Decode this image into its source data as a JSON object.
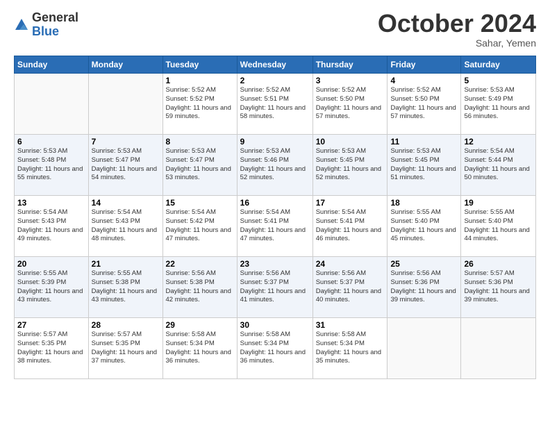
{
  "logo": {
    "general": "General",
    "blue": "Blue"
  },
  "header": {
    "month": "October 2024",
    "location": "Sahar, Yemen"
  },
  "weekdays": [
    "Sunday",
    "Monday",
    "Tuesday",
    "Wednesday",
    "Thursday",
    "Friday",
    "Saturday"
  ],
  "weeks": [
    [
      {
        "day": "",
        "sunrise": "",
        "sunset": "",
        "daylight": ""
      },
      {
        "day": "",
        "sunrise": "",
        "sunset": "",
        "daylight": ""
      },
      {
        "day": "1",
        "sunrise": "Sunrise: 5:52 AM",
        "sunset": "Sunset: 5:52 PM",
        "daylight": "Daylight: 11 hours and 59 minutes."
      },
      {
        "day": "2",
        "sunrise": "Sunrise: 5:52 AM",
        "sunset": "Sunset: 5:51 PM",
        "daylight": "Daylight: 11 hours and 58 minutes."
      },
      {
        "day": "3",
        "sunrise": "Sunrise: 5:52 AM",
        "sunset": "Sunset: 5:50 PM",
        "daylight": "Daylight: 11 hours and 57 minutes."
      },
      {
        "day": "4",
        "sunrise": "Sunrise: 5:52 AM",
        "sunset": "Sunset: 5:50 PM",
        "daylight": "Daylight: 11 hours and 57 minutes."
      },
      {
        "day": "5",
        "sunrise": "Sunrise: 5:53 AM",
        "sunset": "Sunset: 5:49 PM",
        "daylight": "Daylight: 11 hours and 56 minutes."
      }
    ],
    [
      {
        "day": "6",
        "sunrise": "Sunrise: 5:53 AM",
        "sunset": "Sunset: 5:48 PM",
        "daylight": "Daylight: 11 hours and 55 minutes."
      },
      {
        "day": "7",
        "sunrise": "Sunrise: 5:53 AM",
        "sunset": "Sunset: 5:47 PM",
        "daylight": "Daylight: 11 hours and 54 minutes."
      },
      {
        "day": "8",
        "sunrise": "Sunrise: 5:53 AM",
        "sunset": "Sunset: 5:47 PM",
        "daylight": "Daylight: 11 hours and 53 minutes."
      },
      {
        "day": "9",
        "sunrise": "Sunrise: 5:53 AM",
        "sunset": "Sunset: 5:46 PM",
        "daylight": "Daylight: 11 hours and 52 minutes."
      },
      {
        "day": "10",
        "sunrise": "Sunrise: 5:53 AM",
        "sunset": "Sunset: 5:45 PM",
        "daylight": "Daylight: 11 hours and 52 minutes."
      },
      {
        "day": "11",
        "sunrise": "Sunrise: 5:53 AM",
        "sunset": "Sunset: 5:45 PM",
        "daylight": "Daylight: 11 hours and 51 minutes."
      },
      {
        "day": "12",
        "sunrise": "Sunrise: 5:54 AM",
        "sunset": "Sunset: 5:44 PM",
        "daylight": "Daylight: 11 hours and 50 minutes."
      }
    ],
    [
      {
        "day": "13",
        "sunrise": "Sunrise: 5:54 AM",
        "sunset": "Sunset: 5:43 PM",
        "daylight": "Daylight: 11 hours and 49 minutes."
      },
      {
        "day": "14",
        "sunrise": "Sunrise: 5:54 AM",
        "sunset": "Sunset: 5:43 PM",
        "daylight": "Daylight: 11 hours and 48 minutes."
      },
      {
        "day": "15",
        "sunrise": "Sunrise: 5:54 AM",
        "sunset": "Sunset: 5:42 PM",
        "daylight": "Daylight: 11 hours and 47 minutes."
      },
      {
        "day": "16",
        "sunrise": "Sunrise: 5:54 AM",
        "sunset": "Sunset: 5:41 PM",
        "daylight": "Daylight: 11 hours and 47 minutes."
      },
      {
        "day": "17",
        "sunrise": "Sunrise: 5:54 AM",
        "sunset": "Sunset: 5:41 PM",
        "daylight": "Daylight: 11 hours and 46 minutes."
      },
      {
        "day": "18",
        "sunrise": "Sunrise: 5:55 AM",
        "sunset": "Sunset: 5:40 PM",
        "daylight": "Daylight: 11 hours and 45 minutes."
      },
      {
        "day": "19",
        "sunrise": "Sunrise: 5:55 AM",
        "sunset": "Sunset: 5:40 PM",
        "daylight": "Daylight: 11 hours and 44 minutes."
      }
    ],
    [
      {
        "day": "20",
        "sunrise": "Sunrise: 5:55 AM",
        "sunset": "Sunset: 5:39 PM",
        "daylight": "Daylight: 11 hours and 43 minutes."
      },
      {
        "day": "21",
        "sunrise": "Sunrise: 5:55 AM",
        "sunset": "Sunset: 5:38 PM",
        "daylight": "Daylight: 11 hours and 43 minutes."
      },
      {
        "day": "22",
        "sunrise": "Sunrise: 5:56 AM",
        "sunset": "Sunset: 5:38 PM",
        "daylight": "Daylight: 11 hours and 42 minutes."
      },
      {
        "day": "23",
        "sunrise": "Sunrise: 5:56 AM",
        "sunset": "Sunset: 5:37 PM",
        "daylight": "Daylight: 11 hours and 41 minutes."
      },
      {
        "day": "24",
        "sunrise": "Sunrise: 5:56 AM",
        "sunset": "Sunset: 5:37 PM",
        "daylight": "Daylight: 11 hours and 40 minutes."
      },
      {
        "day": "25",
        "sunrise": "Sunrise: 5:56 AM",
        "sunset": "Sunset: 5:36 PM",
        "daylight": "Daylight: 11 hours and 39 minutes."
      },
      {
        "day": "26",
        "sunrise": "Sunrise: 5:57 AM",
        "sunset": "Sunset: 5:36 PM",
        "daylight": "Daylight: 11 hours and 39 minutes."
      }
    ],
    [
      {
        "day": "27",
        "sunrise": "Sunrise: 5:57 AM",
        "sunset": "Sunset: 5:35 PM",
        "daylight": "Daylight: 11 hours and 38 minutes."
      },
      {
        "day": "28",
        "sunrise": "Sunrise: 5:57 AM",
        "sunset": "Sunset: 5:35 PM",
        "daylight": "Daylight: 11 hours and 37 minutes."
      },
      {
        "day": "29",
        "sunrise": "Sunrise: 5:58 AM",
        "sunset": "Sunset: 5:34 PM",
        "daylight": "Daylight: 11 hours and 36 minutes."
      },
      {
        "day": "30",
        "sunrise": "Sunrise: 5:58 AM",
        "sunset": "Sunset: 5:34 PM",
        "daylight": "Daylight: 11 hours and 36 minutes."
      },
      {
        "day": "31",
        "sunrise": "Sunrise: 5:58 AM",
        "sunset": "Sunset: 5:34 PM",
        "daylight": "Daylight: 11 hours and 35 minutes."
      },
      {
        "day": "",
        "sunrise": "",
        "sunset": "",
        "daylight": ""
      },
      {
        "day": "",
        "sunrise": "",
        "sunset": "",
        "daylight": ""
      }
    ]
  ]
}
